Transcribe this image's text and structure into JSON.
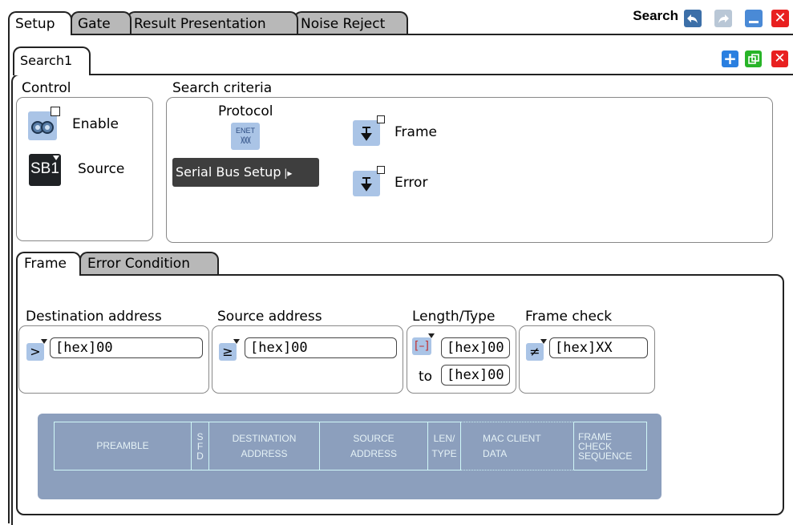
{
  "tabs": [
    "Setup",
    "Gate",
    "Result Presentation",
    "Noise Reject"
  ],
  "window": {
    "title": "Search",
    "undo_icon": "undo-arrow-icon",
    "redo_icon": "redo-arrow-icon",
    "minimize_icon": "minimize-icon",
    "close_icon": "close-icon"
  },
  "subtab": "Search1",
  "subtab_actions": {
    "add_icon": "plus-icon",
    "copy_icon": "copy-icon",
    "delete_icon": "close-icon"
  },
  "control": {
    "label": "Control",
    "enable_label": "Enable",
    "source_label": "Source",
    "source_value": "SB1",
    "enable_icon": "binoculars-icon"
  },
  "criteria": {
    "label": "Search criteria",
    "protocol_label": "Protocol",
    "protocol_icon_text": "ENET",
    "serial_bus_button": "Serial Bus Setup",
    "frame_label": "Frame",
    "error_label": "Error"
  },
  "frame_tabs": [
    "Frame",
    "Error Condition"
  ],
  "fields": {
    "destination": {
      "label": "Destination address",
      "operator": ">",
      "value": "[hex]00"
    },
    "source": {
      "label": "Source address",
      "operator": "≥",
      "value": "[hex]00"
    },
    "length": {
      "label": "Length/Type",
      "operator": "[–]",
      "value": "[hex]00",
      "to_label": "to",
      "to_value": "[hex]00"
    },
    "check": {
      "label": "Frame check",
      "operator": "≠",
      "value": "[hex]XX"
    }
  },
  "diagram": {
    "preamble": "PREAMBLE",
    "sfd": [
      "S",
      "F",
      "D"
    ],
    "destination": [
      "DESTINATION",
      "ADDRESS"
    ],
    "source": [
      "SOURCE",
      "ADDRESS"
    ],
    "lentype": [
      "LEN/",
      "TYPE"
    ],
    "mac": [
      "MAC CLIENT",
      "DATA"
    ],
    "fcs": [
      "FRAME",
      "CHECK",
      "SEQUENCE"
    ]
  },
  "colors": {
    "tab_inactive": "#b8b8b8",
    "icon_blue": "#aac4e6",
    "diagram_bg": "#8c9fbd",
    "diagram_line": "#d0f7f7",
    "button_dark": "#3e3e3e",
    "close_red": "#e82020",
    "add_blue": "#2a7fe0",
    "copy_green": "#28b428"
  }
}
